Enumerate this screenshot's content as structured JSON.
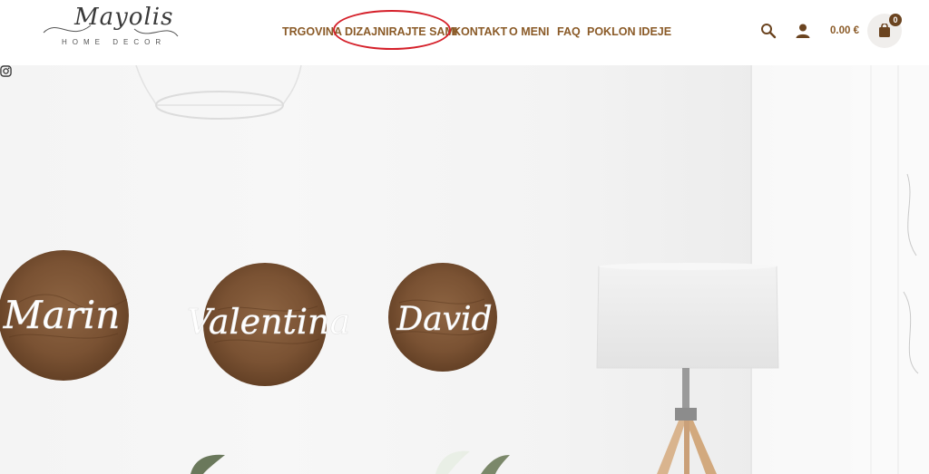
{
  "brand": {
    "logo_text": "Mayolis",
    "logo_subtitle": "HOME DECOR"
  },
  "nav": {
    "items": [
      {
        "label": "TRGOVINA"
      },
      {
        "label": "DIZAJNIRAJTE SAMI"
      },
      {
        "label": "KONTAKT"
      },
      {
        "label": "O MENI"
      },
      {
        "label": "FAQ"
      },
      {
        "label": "POKLON IDEJE"
      }
    ],
    "highlighted_item": "DIZAJNIRAJTE SAMI",
    "highlight_color": "#d5202a"
  },
  "header_actions": {
    "search_icon": "search-icon",
    "account_icon": "user-icon",
    "cart_total": "0.00 €",
    "cart_count": "0",
    "cart_icon": "shopping-bag-icon"
  },
  "colors": {
    "accent": "#8a5a27",
    "badge": "#6b4420",
    "wood": "#7a5233"
  },
  "hero": {
    "name_plaques": [
      {
        "name": "Marin"
      },
      {
        "name": "Valentina"
      },
      {
        "name": "David"
      }
    ],
    "social_icon": "instagram-icon"
  }
}
